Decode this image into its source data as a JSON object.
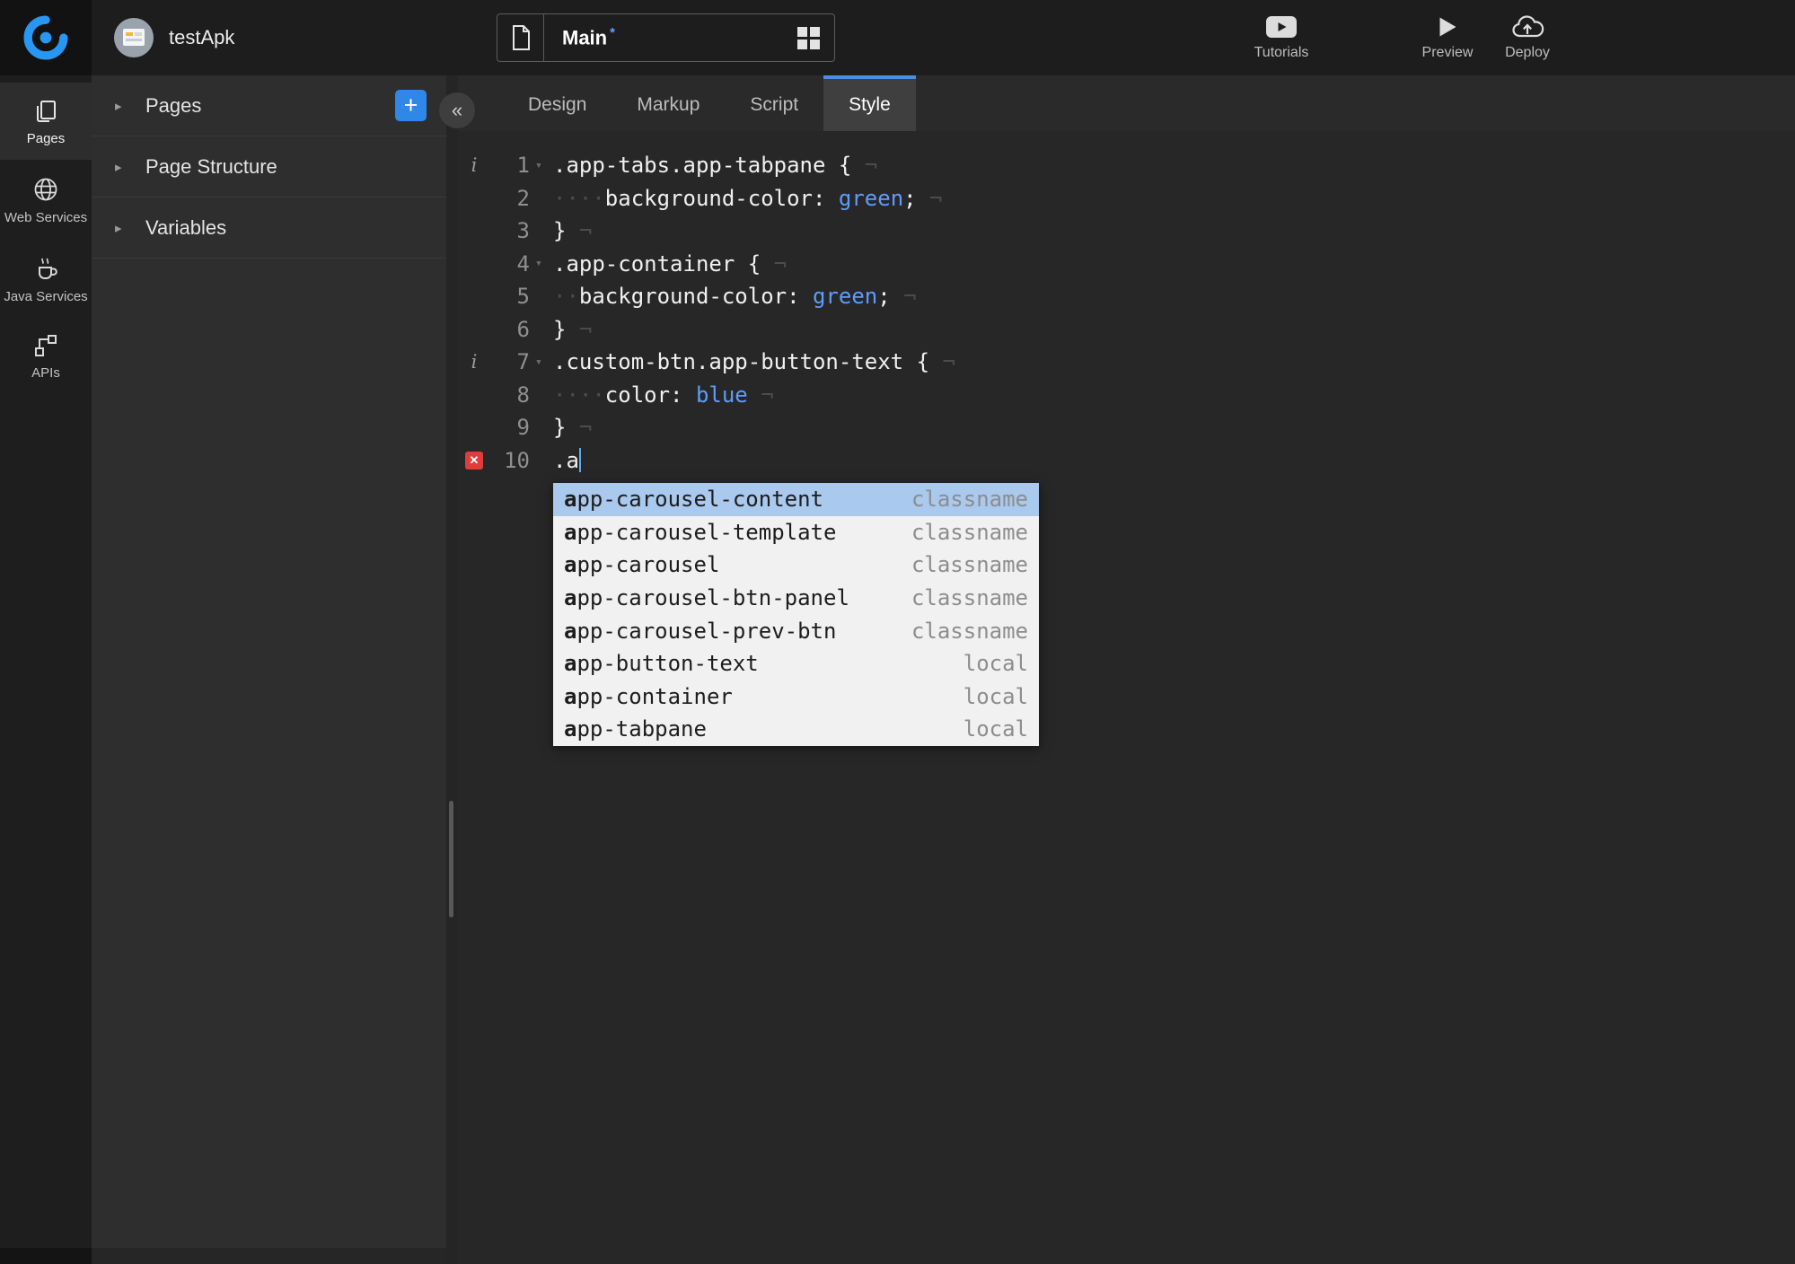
{
  "topbar": {
    "app_name": "testApk",
    "page_selector": {
      "page_name": "Main",
      "modified_marker": "*"
    },
    "actions": {
      "tutorials": "Tutorials",
      "preview": "Preview",
      "deploy": "Deploy"
    }
  },
  "sidebar": {
    "items": [
      {
        "label": "Pages",
        "active": true
      },
      {
        "label": "Web Services",
        "active": false
      },
      {
        "label": "Java Services",
        "active": false
      },
      {
        "label": "APIs",
        "active": false
      }
    ]
  },
  "left_panel": {
    "collapse_button": "«",
    "expand_arrow": "▸",
    "add_button_label": "+",
    "sections": [
      {
        "label": "Pages",
        "has_add_button": true
      },
      {
        "label": "Page Structure",
        "has_add_button": false
      },
      {
        "label": "Variables",
        "has_add_button": false
      }
    ]
  },
  "editor_tabs": {
    "tabs": [
      "Design",
      "Markup",
      "Script",
      "Style"
    ],
    "active": "Style"
  },
  "editor": {
    "language": "css",
    "fold_icon": "▾",
    "info_icon": "i",
    "error_icon": "✕",
    "lines": [
      {
        "number": 1,
        "marker": "info",
        "fold": true,
        "indent": 0,
        "eol": true,
        "cursor": false,
        "segments": [
          {
            "text": ".app-tabs.app-tabpane {",
            "type": "plain"
          }
        ]
      },
      {
        "number": 2,
        "marker": "",
        "fold": false,
        "indent": 4,
        "eol": true,
        "cursor": false,
        "segments": [
          {
            "text": "background-color: ",
            "type": "plain"
          },
          {
            "text": "green",
            "type": "value"
          },
          {
            "text": ";",
            "type": "plain"
          }
        ]
      },
      {
        "number": 3,
        "marker": "",
        "fold": false,
        "indent": 0,
        "eol": true,
        "cursor": false,
        "segments": [
          {
            "text": "}",
            "type": "plain"
          }
        ]
      },
      {
        "number": 4,
        "marker": "",
        "fold": true,
        "indent": 0,
        "eol": true,
        "cursor": false,
        "segments": [
          {
            "text": ".app-container {",
            "type": "plain"
          }
        ]
      },
      {
        "number": 5,
        "marker": "",
        "fold": false,
        "indent": 2,
        "eol": true,
        "cursor": false,
        "segments": [
          {
            "text": "background-color: ",
            "type": "plain"
          },
          {
            "text": "green",
            "type": "value"
          },
          {
            "text": ";",
            "type": "plain"
          }
        ]
      },
      {
        "number": 6,
        "marker": "",
        "fold": false,
        "indent": 0,
        "eol": true,
        "cursor": false,
        "segments": [
          {
            "text": "}",
            "type": "plain"
          }
        ]
      },
      {
        "number": 7,
        "marker": "info",
        "fold": true,
        "indent": 0,
        "eol": true,
        "cursor": false,
        "segments": [
          {
            "text": ".custom-btn.app-button-text {",
            "type": "plain"
          }
        ]
      },
      {
        "number": 8,
        "marker": "",
        "fold": false,
        "indent": 4,
        "eol": true,
        "cursor": false,
        "segments": [
          {
            "text": "color: ",
            "type": "plain"
          },
          {
            "text": "blue",
            "type": "value"
          }
        ]
      },
      {
        "number": 9,
        "marker": "",
        "fold": false,
        "indent": 0,
        "eol": true,
        "cursor": false,
        "segments": [
          {
            "text": "}",
            "type": "plain"
          }
        ]
      },
      {
        "number": 10,
        "marker": "error",
        "fold": false,
        "indent": 0,
        "eol": false,
        "cursor": true,
        "segments": [
          {
            "text": ".a",
            "type": "plain"
          }
        ]
      }
    ],
    "autocomplete": {
      "typed_prefix": "a",
      "items": [
        {
          "label": "app-carousel-content",
          "kind": "classname",
          "selected": true
        },
        {
          "label": "app-carousel-template",
          "kind": "classname",
          "selected": false
        },
        {
          "label": "app-carousel",
          "kind": "classname",
          "selected": false
        },
        {
          "label": "app-carousel-btn-panel",
          "kind": "classname",
          "selected": false
        },
        {
          "label": "app-carousel-prev-btn",
          "kind": "classname",
          "selected": false
        },
        {
          "label": "app-button-text",
          "kind": "local",
          "selected": false
        },
        {
          "label": "app-container",
          "kind": "local",
          "selected": false
        },
        {
          "label": "app-tabpane",
          "kind": "local",
          "selected": false
        }
      ]
    }
  },
  "colors": {
    "accent_blue": "#2f87ea",
    "tab_active_underline": "#4a90e2",
    "code_value": "#5e9cfa",
    "error_red": "#e03c3c",
    "autocomplete_selection": "#a9c9ee"
  }
}
